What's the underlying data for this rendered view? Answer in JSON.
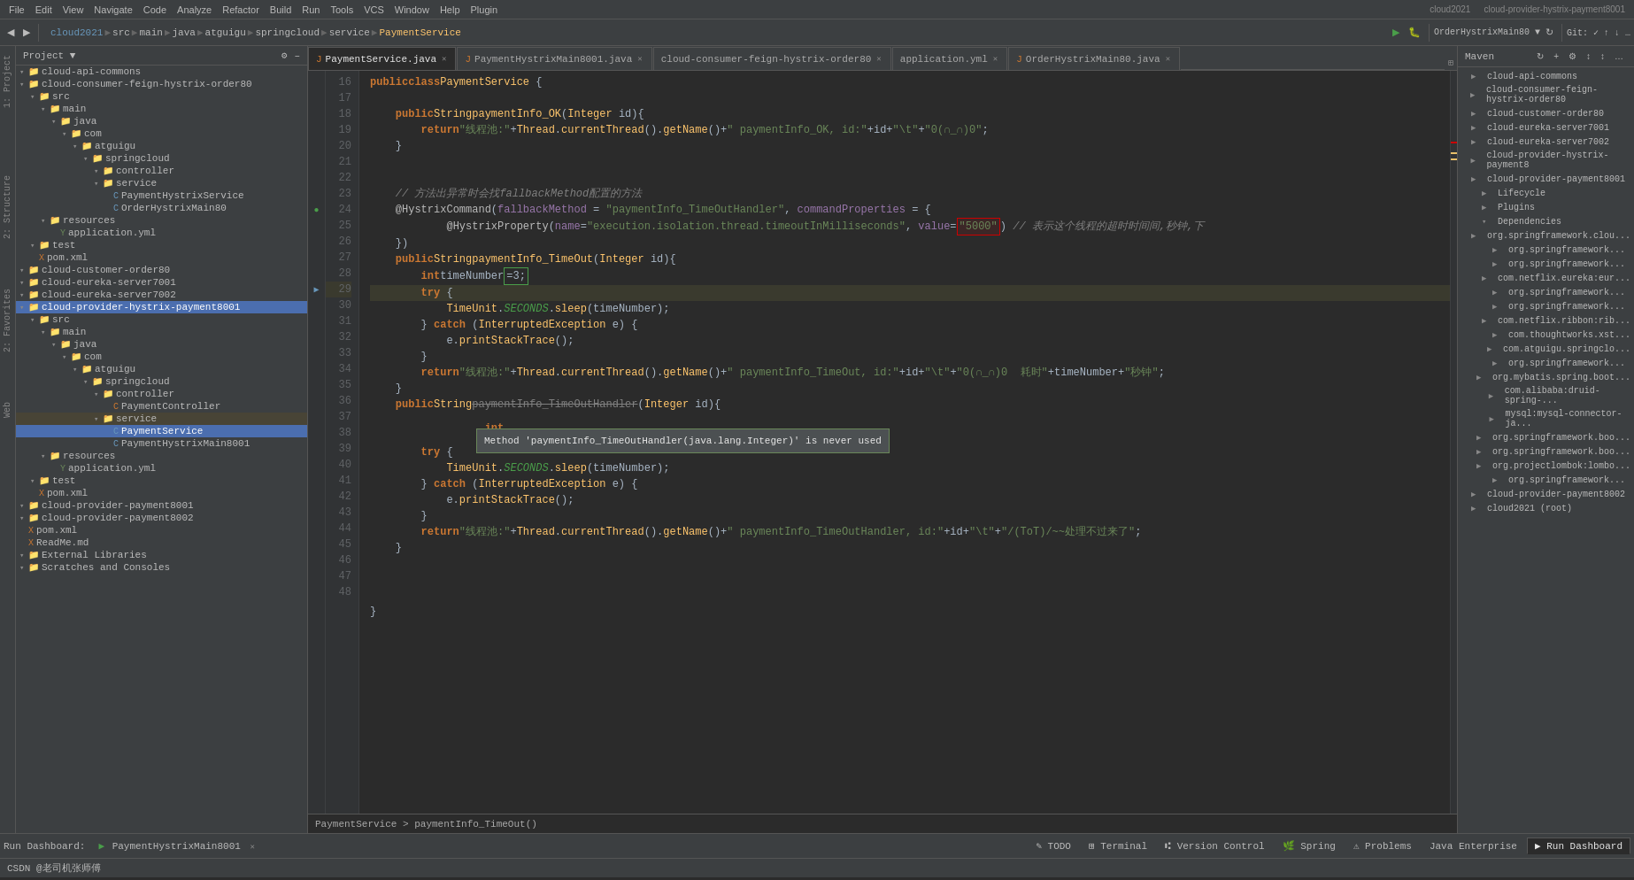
{
  "window": {
    "title": "cloud-provider-hystrix-payment8001",
    "app": "cloud2021"
  },
  "menubar": {
    "items": [
      "File",
      "Edit",
      "View",
      "Navigate",
      "Code",
      "Analyze",
      "Refactor",
      "Build",
      "Run",
      "Tools",
      "VCS",
      "Window",
      "Help",
      "Plugin"
    ]
  },
  "toolbar": {
    "breadcrumbs": [
      "main",
      "java",
      "atguigu",
      "springcloud",
      "service",
      "PaymentService"
    ]
  },
  "tabs": [
    {
      "label": "PaymentService.java",
      "active": true
    },
    {
      "label": "PaymentHystrixMain8001.java",
      "active": false
    },
    {
      "label": "cloud-consumer-feign-hystrix-order80",
      "active": false
    },
    {
      "label": "application.yml",
      "active": false
    },
    {
      "label": "OrderHystrixMain80.java",
      "active": false
    }
  ],
  "project": {
    "header": "Project",
    "items": [
      {
        "level": 0,
        "arrow": "▾",
        "icon": "folder",
        "label": "cloud-api-commons",
        "type": "module"
      },
      {
        "level": 0,
        "arrow": "▾",
        "icon": "folder",
        "label": "cloud-consumer-feign-hystrix-order80",
        "type": "module"
      },
      {
        "level": 1,
        "arrow": "▾",
        "icon": "folder",
        "label": "src",
        "type": "folder"
      },
      {
        "level": 2,
        "arrow": "▾",
        "icon": "folder",
        "label": "main",
        "type": "folder"
      },
      {
        "level": 3,
        "arrow": "▾",
        "icon": "folder",
        "label": "java",
        "type": "folder"
      },
      {
        "level": 4,
        "arrow": "▾",
        "icon": "folder",
        "label": "com",
        "type": "folder"
      },
      {
        "level": 5,
        "arrow": "▾",
        "icon": "folder",
        "label": "atguigu",
        "type": "folder"
      },
      {
        "level": 6,
        "arrow": "▾",
        "icon": "folder",
        "label": "springcloud",
        "type": "folder"
      },
      {
        "level": 7,
        "arrow": "▾",
        "icon": "folder",
        "label": "controller",
        "type": "folder"
      },
      {
        "level": 7,
        "arrow": "▾",
        "icon": "folder",
        "label": "service",
        "type": "folder"
      },
      {
        "level": 8,
        "arrow": " ",
        "icon": "class",
        "label": "PaymentHystrixService",
        "type": "class"
      },
      {
        "level": 8,
        "arrow": " ",
        "icon": "class",
        "label": "OrderHystrixMain80",
        "type": "class"
      },
      {
        "level": 2,
        "arrow": "▾",
        "icon": "folder",
        "label": "resources",
        "type": "folder"
      },
      {
        "level": 3,
        "arrow": " ",
        "icon": "yml",
        "label": "application.yml",
        "type": "file"
      },
      {
        "level": 1,
        "arrow": "▾",
        "icon": "folder",
        "label": "test",
        "type": "folder"
      },
      {
        "level": 1,
        "arrow": " ",
        "icon": "xml",
        "label": "pom.xml",
        "type": "file"
      },
      {
        "level": 0,
        "arrow": "▾",
        "icon": "folder",
        "label": "cloud-customer-order80",
        "type": "module"
      },
      {
        "level": 0,
        "arrow": "▾",
        "icon": "folder",
        "label": "cloud-eureka-server7001",
        "type": "module"
      },
      {
        "level": 0,
        "arrow": "▾",
        "icon": "folder",
        "label": "cloud-eureka-server7002",
        "type": "module"
      },
      {
        "level": 0,
        "arrow": "▾",
        "icon": "folder",
        "label": "cloud-provider-hystrix-payment8001",
        "type": "module",
        "selected": true
      },
      {
        "level": 1,
        "arrow": "▾",
        "icon": "folder",
        "label": "src",
        "type": "folder"
      },
      {
        "level": 2,
        "arrow": "▾",
        "icon": "folder",
        "label": "main",
        "type": "folder"
      },
      {
        "level": 3,
        "arrow": "▾",
        "icon": "folder",
        "label": "java",
        "type": "folder"
      },
      {
        "level": 4,
        "arrow": "▾",
        "icon": "folder",
        "label": "com",
        "type": "folder"
      },
      {
        "level": 5,
        "arrow": "▾",
        "icon": "folder",
        "label": "atguigu",
        "type": "folder"
      },
      {
        "level": 6,
        "arrow": "▾",
        "icon": "folder",
        "label": "springcloud",
        "type": "folder"
      },
      {
        "level": 7,
        "arrow": "▾",
        "icon": "folder",
        "label": "controller",
        "type": "folder"
      },
      {
        "level": 8,
        "arrow": " ",
        "icon": "class",
        "label": "PaymentController",
        "type": "class"
      },
      {
        "level": 7,
        "arrow": "▾",
        "icon": "folder",
        "label": "service",
        "type": "folder",
        "highlighted": true
      },
      {
        "level": 8,
        "arrow": " ",
        "icon": "class",
        "label": "PaymentService",
        "type": "class",
        "selected": true
      },
      {
        "level": 8,
        "arrow": " ",
        "icon": "class",
        "label": "PaymentHystrixMain8001",
        "type": "class"
      },
      {
        "level": 2,
        "arrow": "▾",
        "icon": "folder",
        "label": "resources",
        "type": "folder"
      },
      {
        "level": 3,
        "arrow": " ",
        "icon": "yml",
        "label": "application.yml",
        "type": "file"
      },
      {
        "level": 1,
        "arrow": "▾",
        "icon": "folder",
        "label": "test",
        "type": "folder"
      },
      {
        "level": 1,
        "arrow": " ",
        "icon": "xml",
        "label": "pom.xml",
        "type": "file"
      },
      {
        "level": 0,
        "arrow": "▾",
        "icon": "folder",
        "label": "cloud-provider-payment8001",
        "type": "module"
      },
      {
        "level": 0,
        "arrow": "▾",
        "icon": "folder",
        "label": "cloud-provider-payment8002",
        "type": "module"
      },
      {
        "level": 0,
        "arrow": " ",
        "icon": "xml",
        "label": "pom.xml",
        "type": "file"
      },
      {
        "level": 0,
        "arrow": " ",
        "icon": "xml",
        "label": "ReadMe.md",
        "type": "file"
      },
      {
        "level": 0,
        "arrow": "▾",
        "icon": "folder",
        "label": "External Libraries",
        "type": "module"
      },
      {
        "level": 0,
        "arrow": "▾",
        "icon": "folder",
        "label": "Scratches and Consoles",
        "type": "module"
      }
    ]
  },
  "code": {
    "lines": [
      {
        "num": 16,
        "content_type": "class_decl",
        "text": "public class PaymentService {"
      },
      {
        "num": 17,
        "content_type": "blank",
        "text": ""
      },
      {
        "num": 18,
        "content_type": "method",
        "text": "    public String paymentInfo_OK(Integer id){"
      },
      {
        "num": 19,
        "content_type": "return",
        "text": "        return \"线程池:\"+Thread.currentThread().getName()+\" paymentInfo_OK, id:\"+id+\"\\t\"+\"0(∩_∩)0\";"
      },
      {
        "num": 20,
        "content_type": "close",
        "text": "    }"
      },
      {
        "num": 21,
        "content_type": "blank",
        "text": ""
      },
      {
        "num": 22,
        "content_type": "blank",
        "text": ""
      },
      {
        "num": 23,
        "content_type": "comment",
        "text": "    // 方法出异常时会找fallbackMethod配置的方法"
      },
      {
        "num": 24,
        "content_type": "annotation",
        "text": "    @HystrixCommand(fallbackMethod = \"paymentInfo_TimeOutHandler\", commandProperties = {"
      },
      {
        "num": 25,
        "content_type": "annotation2",
        "text": "            @HystrixProperty(name=\"execution.isolation.thread.timeoutInMilliseconds\", value=\"5000\") // 表示这个线程的超时时间间,秒钟,下"
      },
      {
        "num": 26,
        "content_type": "close",
        "text": "    })"
      },
      {
        "num": 27,
        "content_type": "method",
        "text": "    public String paymentInfo_TimeOut(Integer id){"
      },
      {
        "num": 28,
        "content_type": "decl",
        "text": "        int timeNumber =3;"
      },
      {
        "num": 29,
        "content_type": "try",
        "text": "        try {",
        "highlighted": true
      },
      {
        "num": 30,
        "content_type": "stmt",
        "text": "            TimeUnit.SECONDS.sleep(timeNumber);"
      },
      {
        "num": 31,
        "content_type": "catch",
        "text": "        } catch (InterruptedException e) {"
      },
      {
        "num": 32,
        "content_type": "stmt",
        "text": "            e.printStackTrace();"
      },
      {
        "num": 33,
        "content_type": "close",
        "text": "        }"
      },
      {
        "num": 34,
        "content_type": "return",
        "text": "        return \"线程池:\"+Thread.currentThread().getName()+\" paymentInfo_TimeOut, id:\"+id+\"\\t\"+\"0(∩_∩)0  耗时\"+timeNumber+\"秒钟\";"
      },
      {
        "num": 35,
        "content_type": "close",
        "text": "    }"
      },
      {
        "num": 36,
        "content_type": "method",
        "text": "    public String paymentInfo_TimeOutHandler(Integer id){"
      },
      {
        "num": 37,
        "content_type": "decl",
        "text": "        int"
      },
      {
        "num": 38,
        "content_type": "try2",
        "text": "        try {"
      },
      {
        "num": 39,
        "content_type": "stmt",
        "text": "            TimeUnit.SECONDS.sleep(timeNumber);"
      },
      {
        "num": 40,
        "content_type": "catch2",
        "text": "        } catch (InterruptedException e) {"
      },
      {
        "num": 41,
        "content_type": "stmt",
        "text": "            e.printStackTrace();"
      },
      {
        "num": 42,
        "content_type": "close",
        "text": "        }"
      },
      {
        "num": 43,
        "content_type": "return",
        "text": "        return \"线程池:\"+Thread.currentThread().getName()+\" paymentInfo_TimeOutHandler, id:\"+id+\"\\t\"+\"/(ToT)/~~处理不过来了\";"
      },
      {
        "num": 44,
        "content_type": "close",
        "text": "    }"
      },
      {
        "num": 45,
        "content_type": "blank",
        "text": ""
      },
      {
        "num": 46,
        "content_type": "blank",
        "text": ""
      },
      {
        "num": 47,
        "content_type": "blank",
        "text": ""
      },
      {
        "num": 48,
        "content_type": "close_class",
        "text": "}"
      }
    ],
    "tooltip": "Method 'paymentInfo_TimeOutHandler(java.lang.Integer)' is never used",
    "tooltip_line": 37
  },
  "maven": {
    "header": "Maven",
    "items": [
      {
        "label": "cloud-api-commons",
        "level": 0,
        "arrow": "▶"
      },
      {
        "label": "cloud-consumer-feign-hystrix-order80",
        "level": 0,
        "arrow": "▶"
      },
      {
        "label": "cloud-customer-order80",
        "level": 0,
        "arrow": "▶"
      },
      {
        "label": "cloud-eureka-server7001",
        "level": 0,
        "arrow": "▶"
      },
      {
        "label": "cloud-eureka-server7002",
        "level": 0,
        "arrow": "▶"
      },
      {
        "label": "cloud-provider-hystrix-payment8",
        "level": 0,
        "arrow": "▶"
      },
      {
        "label": "cloud-provider-payment8001",
        "level": 0,
        "arrow": "▶"
      },
      {
        "label": "Lifecycle",
        "level": 1,
        "arrow": "▶"
      },
      {
        "label": "Plugins",
        "level": 1,
        "arrow": "▶"
      },
      {
        "label": "Dependencies",
        "level": 1,
        "arrow": "▾"
      },
      {
        "label": "org.springframework.clou...",
        "level": 2,
        "arrow": "▶"
      },
      {
        "label": "org.springframework...",
        "level": 2,
        "arrow": "▶"
      },
      {
        "label": "org.springframework...",
        "level": 2,
        "arrow": "▶"
      },
      {
        "label": "com.netflix.eureka:eur...",
        "level": 2,
        "arrow": "▶"
      },
      {
        "label": "org.springframework...",
        "level": 2,
        "arrow": "▶"
      },
      {
        "label": "org.springframework...",
        "level": 2,
        "arrow": "▶"
      },
      {
        "label": "com.netflix.ribbon:rib...",
        "level": 2,
        "arrow": "▶"
      },
      {
        "label": "com.thoughtworks.xst...",
        "level": 2,
        "arrow": "▶"
      },
      {
        "label": "com.atguigu.springclo...",
        "level": 2,
        "arrow": "▶"
      },
      {
        "label": "org.springframework...",
        "level": 2,
        "arrow": "▶"
      },
      {
        "label": "org.mybatis.spring.boot...",
        "level": 2,
        "arrow": "▶"
      },
      {
        "label": "com.alibaba:druid-spring-...",
        "level": 2,
        "arrow": "▶"
      },
      {
        "label": "mysql:mysql-connector-ja...",
        "level": 2,
        "arrow": "▶"
      },
      {
        "label": "org.springframework.boo...",
        "level": 2,
        "arrow": "▶"
      },
      {
        "label": "org.springframework.boo...",
        "level": 2,
        "arrow": "▶"
      },
      {
        "label": "org.projectlombok:lombo...",
        "level": 2,
        "arrow": "▶"
      },
      {
        "label": "org.springframework...",
        "level": 2,
        "arrow": "▶"
      },
      {
        "label": "cloud-provider-payment8002",
        "level": 0,
        "arrow": "▶"
      },
      {
        "label": "cloud2021 (root)",
        "level": 0,
        "arrow": "▶"
      }
    ]
  },
  "bottombar": {
    "run_dashboard_label": "Run Dashboard:",
    "run_dashboard_item": "PaymentHystrixMain8001",
    "tabs": [
      "TODO",
      "Terminal",
      "Version Control",
      "Spring",
      "Problems",
      "Java Enterprise",
      "Run Dashboard"
    ]
  },
  "breadcrumb_path": "PaymentService > paymentInfo_TimeOut()",
  "statusbar": {
    "git": "Git:",
    "items": [
      "CSDN @老司机张师傅"
    ]
  }
}
